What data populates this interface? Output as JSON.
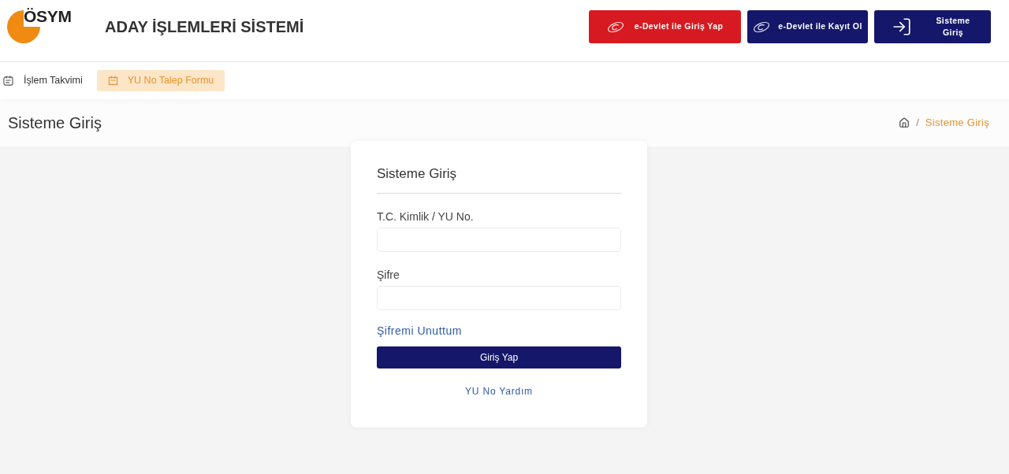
{
  "header": {
    "logo_text": "ÖSYM",
    "title": "ADAY İŞLEMLERİ SİSTEMİ",
    "buttons": [
      {
        "kind": "edevlet",
        "label": "e-Devlet ile Giriş Yap",
        "color": "#d71a21"
      },
      {
        "kind": "edevlet",
        "label": "e-Devlet ile Kayıt Ol",
        "color": "#15176b"
      },
      {
        "kind": "login",
        "label": "Sisteme Giriş",
        "color": "#15176b"
      }
    ]
  },
  "nav": {
    "items": [
      {
        "label": "İşlem Takvimi",
        "selected": false
      },
      {
        "label": "YU No Talep Formu",
        "selected": true
      }
    ]
  },
  "page_header": {
    "title": "Sisteme Giriş",
    "breadcrumb": {
      "separator": "/",
      "current": "Sisteme Giriş"
    }
  },
  "login_form": {
    "title": "Sisteme Giriş",
    "fields": [
      {
        "label": "T.C. Kimlik / YU No."
      },
      {
        "label": "Şifre"
      }
    ],
    "forgot_link": "Şifremi Unuttum",
    "submit": "Giriş Yap",
    "help_link": "YU No Yardım"
  }
}
